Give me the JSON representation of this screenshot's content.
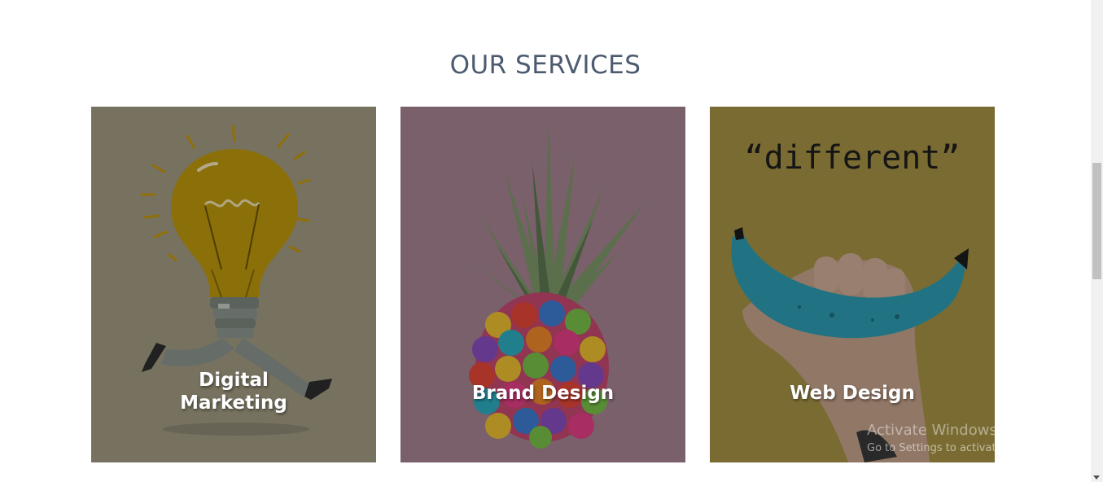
{
  "section": {
    "title": "OUR SERVICES"
  },
  "services": [
    {
      "label": "Digital\nMarketing",
      "image": "lightbulb-running-illustration",
      "bg": "#a59e84"
    },
    {
      "label": "Brand Design",
      "image": "rainbow-pineapple-photo",
      "bg": "#a88694"
    },
    {
      "label": "Web Design",
      "image": "blue-banana-photo",
      "bg": "#a89546"
    }
  ],
  "card3_quote": "“different”",
  "watermark": {
    "line1": "Activate Windows",
    "line2": "Go to Settings to activate Windows."
  }
}
